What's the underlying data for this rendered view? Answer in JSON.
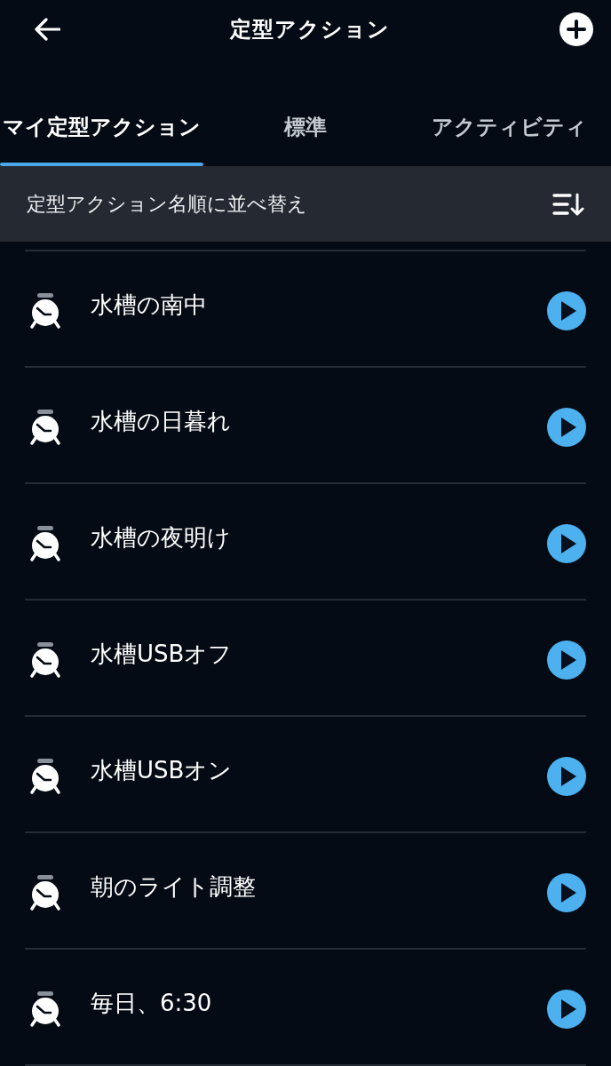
{
  "header": {
    "title": "定型アクション"
  },
  "tabs": [
    {
      "label": "マイ定型アクション",
      "selected": true
    },
    {
      "label": "標準",
      "selected": false
    },
    {
      "label": "アクティビティ",
      "selected": false
    }
  ],
  "sort_bar": {
    "label": "定型アクション名順に並べ替え"
  },
  "routines": [
    {
      "name": "水槽の南中"
    },
    {
      "name": "水槽の日暮れ"
    },
    {
      "name": "水槽の夜明け"
    },
    {
      "name": "水槽USBオフ"
    },
    {
      "name": "水槽USBオン"
    },
    {
      "name": "朝のライト調整"
    },
    {
      "name": "毎日、6:30"
    }
  ]
}
